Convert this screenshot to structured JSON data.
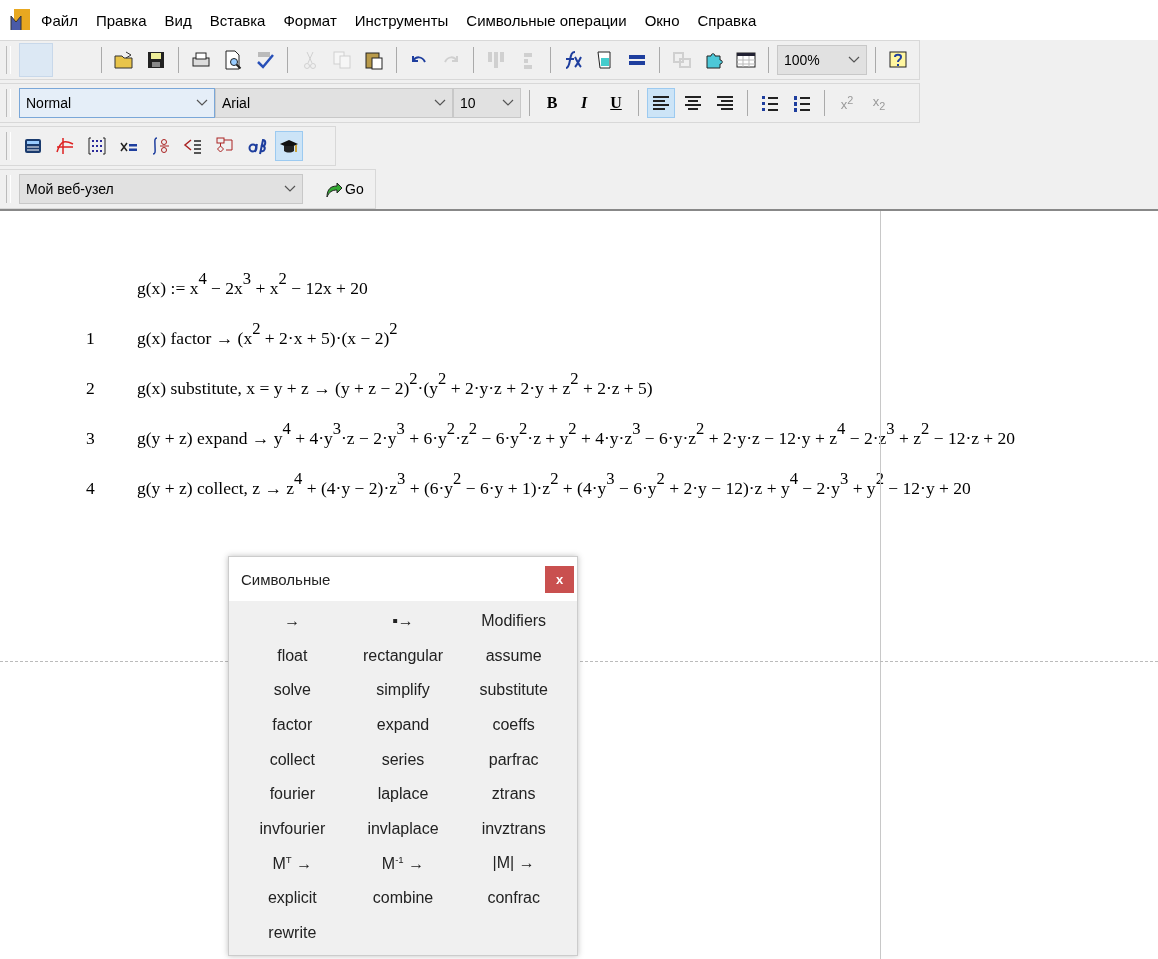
{
  "menu": [
    "Файл",
    "Правка",
    "Вид",
    "Вставка",
    "Формат",
    "Инструменты",
    "Символьные операции",
    "Окно",
    "Справка"
  ],
  "standard_toolbar": {
    "items": [
      {
        "kind": "blank"
      },
      {
        "kind": "sep"
      },
      {
        "kind": "open",
        "disabled": false
      },
      {
        "kind": "save",
        "disabled": false
      },
      {
        "kind": "sep"
      },
      {
        "kind": "print",
        "disabled": false
      },
      {
        "kind": "preview",
        "disabled": false
      },
      {
        "kind": "spell",
        "disabled": false
      },
      {
        "kind": "sep"
      },
      {
        "kind": "cut",
        "disabled": true
      },
      {
        "kind": "copy",
        "disabled": true
      },
      {
        "kind": "paste",
        "disabled": false
      },
      {
        "kind": "sep"
      },
      {
        "kind": "undo",
        "disabled": false
      },
      {
        "kind": "redo",
        "disabled": true
      },
      {
        "kind": "sep"
      },
      {
        "kind": "align-top",
        "disabled": true
      },
      {
        "kind": "align-bottom",
        "disabled": true
      },
      {
        "kind": "sep"
      },
      {
        "kind": "function",
        "disabled": false
      },
      {
        "kind": "unit",
        "disabled": false
      },
      {
        "kind": "equals",
        "disabled": false
      },
      {
        "kind": "sep"
      },
      {
        "kind": "link",
        "disabled": true
      },
      {
        "kind": "component",
        "disabled": false
      },
      {
        "kind": "table",
        "disabled": false
      },
      {
        "kind": "sep"
      }
    ],
    "zoom": "100%"
  },
  "format_toolbar": {
    "style": "Normal",
    "font": "Arial",
    "size": "10",
    "bold": "B",
    "italic": "I",
    "underline": "U",
    "align": [
      {
        "kind": "left",
        "selected": true
      },
      {
        "kind": "center",
        "selected": false
      },
      {
        "kind": "right",
        "selected": false
      }
    ],
    "superscript": "x$^{2}$",
    "subscript": "x$_{2}$"
  },
  "math_toolbar": [
    {
      "kind": "calculator",
      "selected": false
    },
    {
      "kind": "graph",
      "selected": false
    },
    {
      "kind": "matrix",
      "selected": false
    },
    {
      "kind": "evaluation",
      "selected": false
    },
    {
      "kind": "calculus",
      "selected": false
    },
    {
      "kind": "boolean",
      "selected": false
    },
    {
      "kind": "programming",
      "selected": false
    },
    {
      "kind": "greek",
      "selected": false
    },
    {
      "kind": "symbolic",
      "selected": true
    }
  ],
  "web_toolbar": {
    "address": "Мой веб-узел",
    "go": "Go"
  },
  "worksheet": {
    "definition": "g(x) := x$^{4}$ − 2x$^{3}$ + x$^{2}$ − 12x + 20",
    "lines": [
      {
        "number": "1",
        "expression": "g(x) factor  → (x$^{2}$ + 2·x + 5)·(x − 2)$^{2}$"
      },
      {
        "number": "2",
        "expression": "g(x) substitute, x = y + z  → (y + z − 2)$^{2}$·(y$^{2}$ + 2·y·z + 2·y + z$^{2}$ + 2·z + 5)"
      },
      {
        "number": "3",
        "expression": "g(y + z) expand  → y$^{4}$ + 4·y$^{3}$·z − 2·y$^{3}$ + 6·y$^{2}$·z$^{2}$ − 6·y$^{2}$·z + y$^{2}$ + 4·y·z$^{3}$ − 6·y·z$^{2}$ + 2·y·z − 12·y + z$^{4}$ − 2·z$^{3}$ + z$^{2}$ − 12·z + 20"
      },
      {
        "number": "4",
        "expression": "g(y + z) collect, z  → z$^{4}$ + (4·y − 2)·z$^{3}$ + (6·y$^{2}$ − 6·y + 1)·z$^{2}$ + (4·y$^{3}$ − 6·y$^{2}$ + 2·y − 12)·z + y$^{4}$ − 2·y$^{3}$ + y$^{2}$ − 12·y + 20"
      }
    ]
  },
  "palette": {
    "title": "Символьные",
    "close": "x",
    "buttons": [
      "→",
      "▪→",
      "Modifiers",
      "float",
      "rectangular",
      "assume",
      "solve",
      "simplify",
      "substitute",
      "factor",
      "expand",
      "coeffs",
      "collect",
      "series",
      "parfrac",
      "fourier",
      "laplace",
      "ztrans",
      "invfourier",
      "invlaplace",
      "invztrans",
      "M$^{T}$ →",
      "M$^{-1}$ →",
      "|M| →",
      "explicit",
      "combine",
      "confrac",
      "rewrite"
    ]
  }
}
